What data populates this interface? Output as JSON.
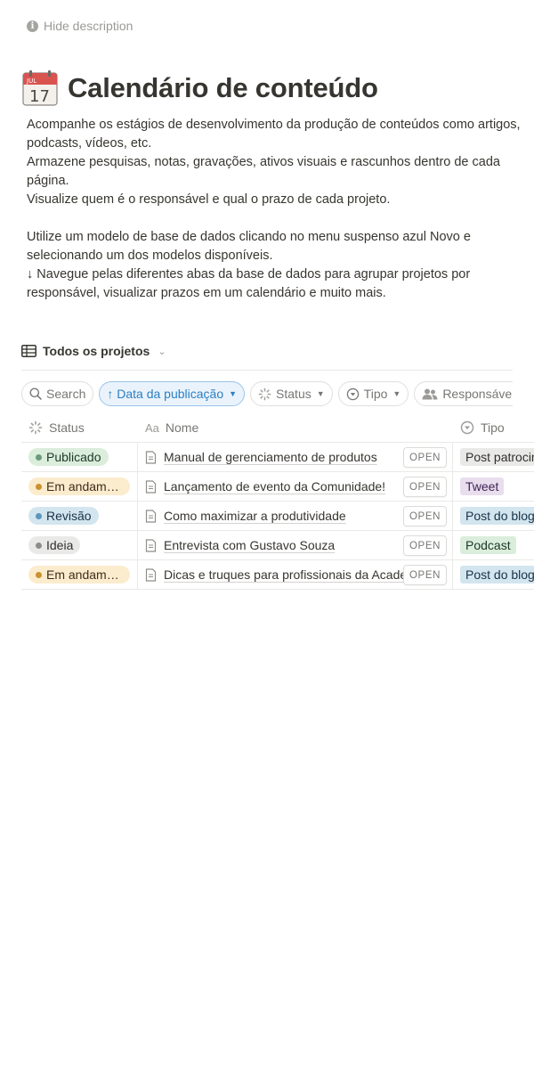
{
  "header": {
    "hide_description": "Hide description"
  },
  "page": {
    "title": "Calendário de conteúdo"
  },
  "cal_icon": {
    "month": "JUL",
    "day": "17"
  },
  "description": [
    "Acompanhe os estágios de desenvolvimento da produção de conteúdos como artigos, podcasts, vídeos, etc.",
    "Armazene pesquisas, notas, gravações, ativos visuais e rascunhos dentro de cada página.",
    "Visualize quem é o responsável e qual o prazo de cada projeto.",
    "",
    "Utilize um modelo de base de dados clicando no menu suspenso azul Novo e selecionando um dos modelos disponíveis.",
    "↓ Navegue pelas diferentes abas da base de dados para agrupar projetos por responsável, visualizar prazos em um calendário e muito mais."
  ],
  "view": {
    "label": "Todos os projetos",
    "icon": "table-icon"
  },
  "filters": {
    "search": "Search",
    "sort": "↑ Data da publicação",
    "status": "Status",
    "tipo": "Tipo",
    "responsavel": "Responsável"
  },
  "columns": {
    "status": "Status",
    "name": "Nome",
    "type": "Tipo"
  },
  "open_label": "OPEN",
  "colors": {
    "green_bg": "#dbeddb",
    "green_dot": "#6c9b7d",
    "yellow_bg": "#fbeccd",
    "yellow_dot": "#cb912f",
    "blue_bg": "#d3e5ef",
    "blue_dot": "#5b97bd",
    "gray_bg": "#e9e9e7",
    "gray_dot": "#8e8d89",
    "purple_bg": "#e8deee"
  },
  "rows": [
    {
      "status": "Publicado",
      "name": "Manual de gerenciamento de produtos",
      "type": "Post patrocinado"
    },
    {
      "status": "Em andamento",
      "name": "Lançamento de evento da Comunidade!",
      "type": "Tweet"
    },
    {
      "status": "Revisão",
      "name": "Como maximizar a produtividade",
      "type": "Post do blog"
    },
    {
      "status": "Ideia",
      "name": "Entrevista com Gustavo Souza",
      "type": "Podcast"
    },
    {
      "status": "Em andamento",
      "name": "Dicas e truques para profissionais da Academia",
      "type": "Post do blog"
    }
  ]
}
